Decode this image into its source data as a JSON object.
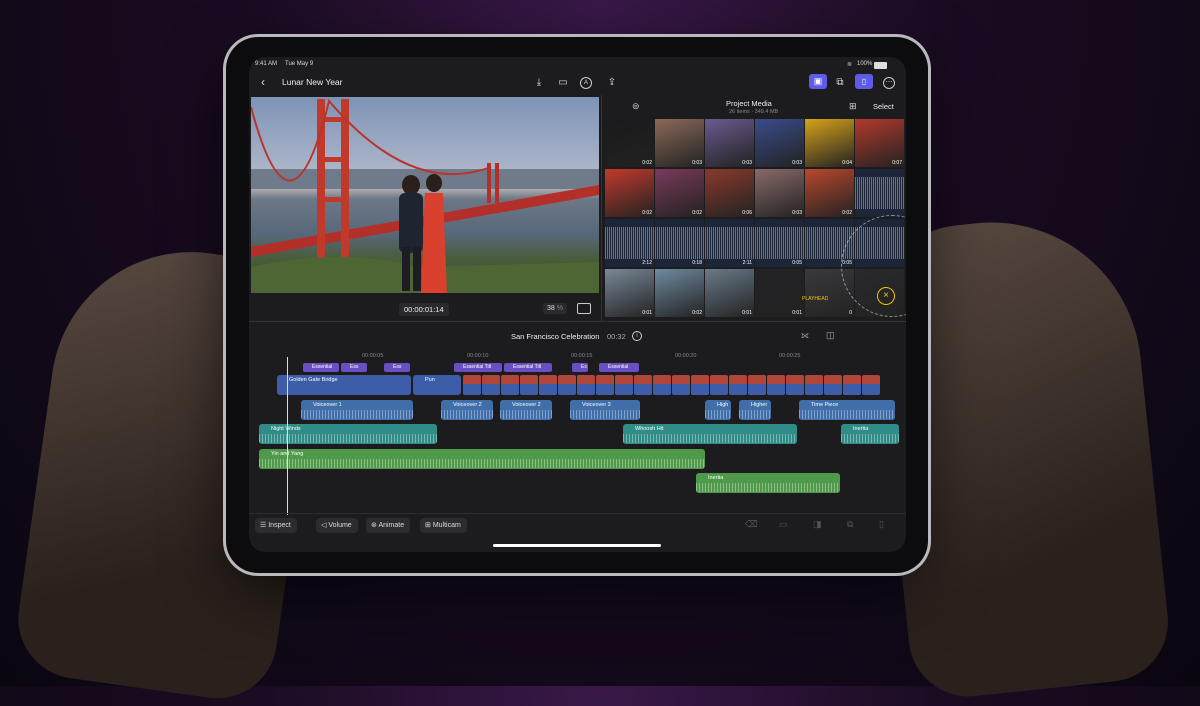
{
  "status_bar": {
    "time": "9:41 AM",
    "date": "Tue May 9",
    "battery": "100%"
  },
  "header": {
    "project_title": "Lunar New Year"
  },
  "viewer": {
    "timecode": "00:00:01:14",
    "zoom": "38",
    "zoom_unit": "%"
  },
  "browser": {
    "title": "Project Media",
    "subtitle": "26 items · 349.4 MB",
    "select_label": "Select",
    "thumbnails": [
      {
        "duration": "0:02",
        "kind": "video"
      },
      {
        "duration": "0:03",
        "kind": "video"
      },
      {
        "duration": "0:03",
        "kind": "video"
      },
      {
        "duration": "0:03",
        "kind": "video"
      },
      {
        "duration": "0:04",
        "kind": "video"
      },
      {
        "duration": "0:07",
        "kind": "video"
      },
      {
        "duration": "0:02",
        "kind": "video"
      },
      {
        "duration": "0:02",
        "kind": "video"
      },
      {
        "duration": "0:06",
        "kind": "video"
      },
      {
        "duration": "0:03",
        "kind": "video"
      },
      {
        "duration": "0:02",
        "kind": "video"
      },
      {
        "duration": "",
        "kind": "audio"
      },
      {
        "duration": "2:12",
        "kind": "audio"
      },
      {
        "duration": "0:18",
        "kind": "audio"
      },
      {
        "duration": "2:11",
        "kind": "audio"
      },
      {
        "duration": "0:05",
        "kind": "audio"
      },
      {
        "duration": "0:05",
        "kind": "audio"
      },
      {
        "duration": "",
        "kind": "audio"
      },
      {
        "duration": "0:01",
        "kind": "video"
      },
      {
        "duration": "0:02",
        "kind": "video"
      },
      {
        "duration": "0:01",
        "kind": "video"
      },
      {
        "duration": "0:01",
        "kind": "video"
      },
      {
        "duration": "0",
        "kind": "video"
      },
      {
        "duration": "",
        "kind": "video"
      }
    ],
    "playhead_label": "PLAYHEAD"
  },
  "timeline": {
    "project_name": "San Francisco Celebration",
    "duration": "00:32",
    "ruler": [
      "00:00:05",
      "00:00:10",
      "00:00:15",
      "00:00:20",
      "00:00:25"
    ],
    "titles": [
      "Essential",
      "Ess",
      "Ess",
      "Essential Titl",
      "Essential Titl",
      "Es",
      "Essential"
    ],
    "primary_clips": [
      "Golden Gate Bridge",
      "Pun"
    ],
    "voiceovers": [
      "Voiceover 1",
      "Voiceover 2",
      "Voiceover 2",
      "Voiceover 3",
      "High",
      "Higher",
      "Time Piece"
    ],
    "audio_lane_1": [
      "Night Winds",
      "Whoosh Hit",
      "Inertia"
    ],
    "music": "Yin and Yang",
    "audio_lane_3": "Inertia"
  },
  "toolbar": {
    "inspect": "Inspect",
    "volume": "Volume",
    "animate": "Animate",
    "multicam": "Multicam"
  },
  "colors": {
    "accent": "#5e5ce6",
    "title_clip": "#6a4fc2",
    "primary_clip": "#3d5da8",
    "voiceover_clip": "#3f6ea8",
    "audio_clip": "#2f8c86",
    "music_clip": "#4f9a4a"
  }
}
